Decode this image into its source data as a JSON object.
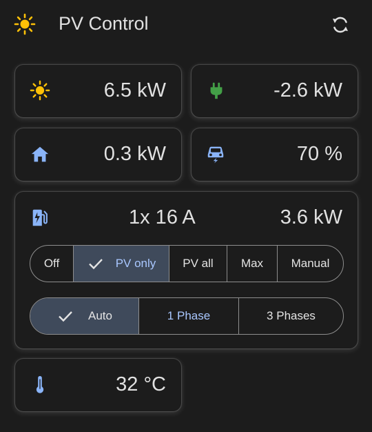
{
  "header": {
    "title": "PV Control"
  },
  "tiles": {
    "solar": {
      "value": "6.5 kW",
      "icon": "sun-icon",
      "color": "#ffc107"
    },
    "grid": {
      "value": "-2.6 kW",
      "icon": "plug-icon",
      "color": "#43a047"
    },
    "home": {
      "value": "0.3 kW",
      "icon": "home-icon",
      "color": "#8ab4f8"
    },
    "car": {
      "value": "70 %",
      "icon": "car-charging-icon",
      "color": "#8ab4f8"
    },
    "temperature": {
      "value": "32 °C",
      "icon": "thermometer-icon",
      "color": "#8ab4f8"
    }
  },
  "charger": {
    "icon": "ev-station-icon",
    "current": "1x 16 A",
    "power": "3.6 kW",
    "modes": [
      {
        "label": "Off",
        "selected": false
      },
      {
        "label": "PV only",
        "selected": true
      },
      {
        "label": "PV all",
        "selected": false
      },
      {
        "label": "Max",
        "selected": false
      },
      {
        "label": "Manual",
        "selected": false
      }
    ],
    "phases": [
      {
        "label": "Auto",
        "selected": true
      },
      {
        "label": "1 Phase",
        "selected": false
      },
      {
        "label": "3 Phases",
        "selected": false
      }
    ]
  },
  "colors": {
    "background": "#1c1c1c",
    "selected_bg": "#3f4a5b",
    "accent": "#a9c7ff",
    "sun": "#ffc107"
  }
}
